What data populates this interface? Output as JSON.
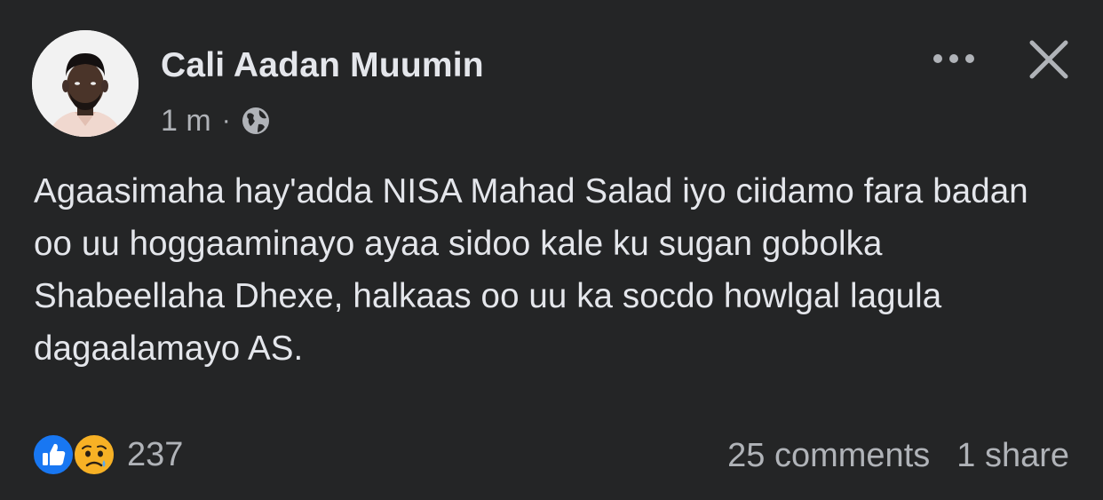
{
  "post": {
    "author": "Cali Aadan Muumin",
    "timestamp": "1 m",
    "separator": "·",
    "privacy_icon": "globe-icon",
    "text": "Agaasimaha hay'adda NISA Mahad Salad iyo ciidamo fara badan oo uu hoggaaminayo ayaa sidoo kale ku sugan gobolka Shabeellaha Dhexe, halkaas oo uu ka socdo howlgal lagula dagaalamayo AS."
  },
  "header_actions": {
    "more_icon": "more-options-icon",
    "close_icon": "close-icon"
  },
  "reactions": {
    "icons": [
      "like-icon",
      "sad-icon"
    ],
    "count": "237"
  },
  "stats": {
    "comments": "25 comments",
    "shares": "1 share"
  },
  "colors": {
    "background": "#242526",
    "primary_text": "#e4e6eb",
    "secondary_text": "#b0b3b8",
    "like_blue": "#1877f2",
    "sad_yellow": "#f7b125"
  }
}
